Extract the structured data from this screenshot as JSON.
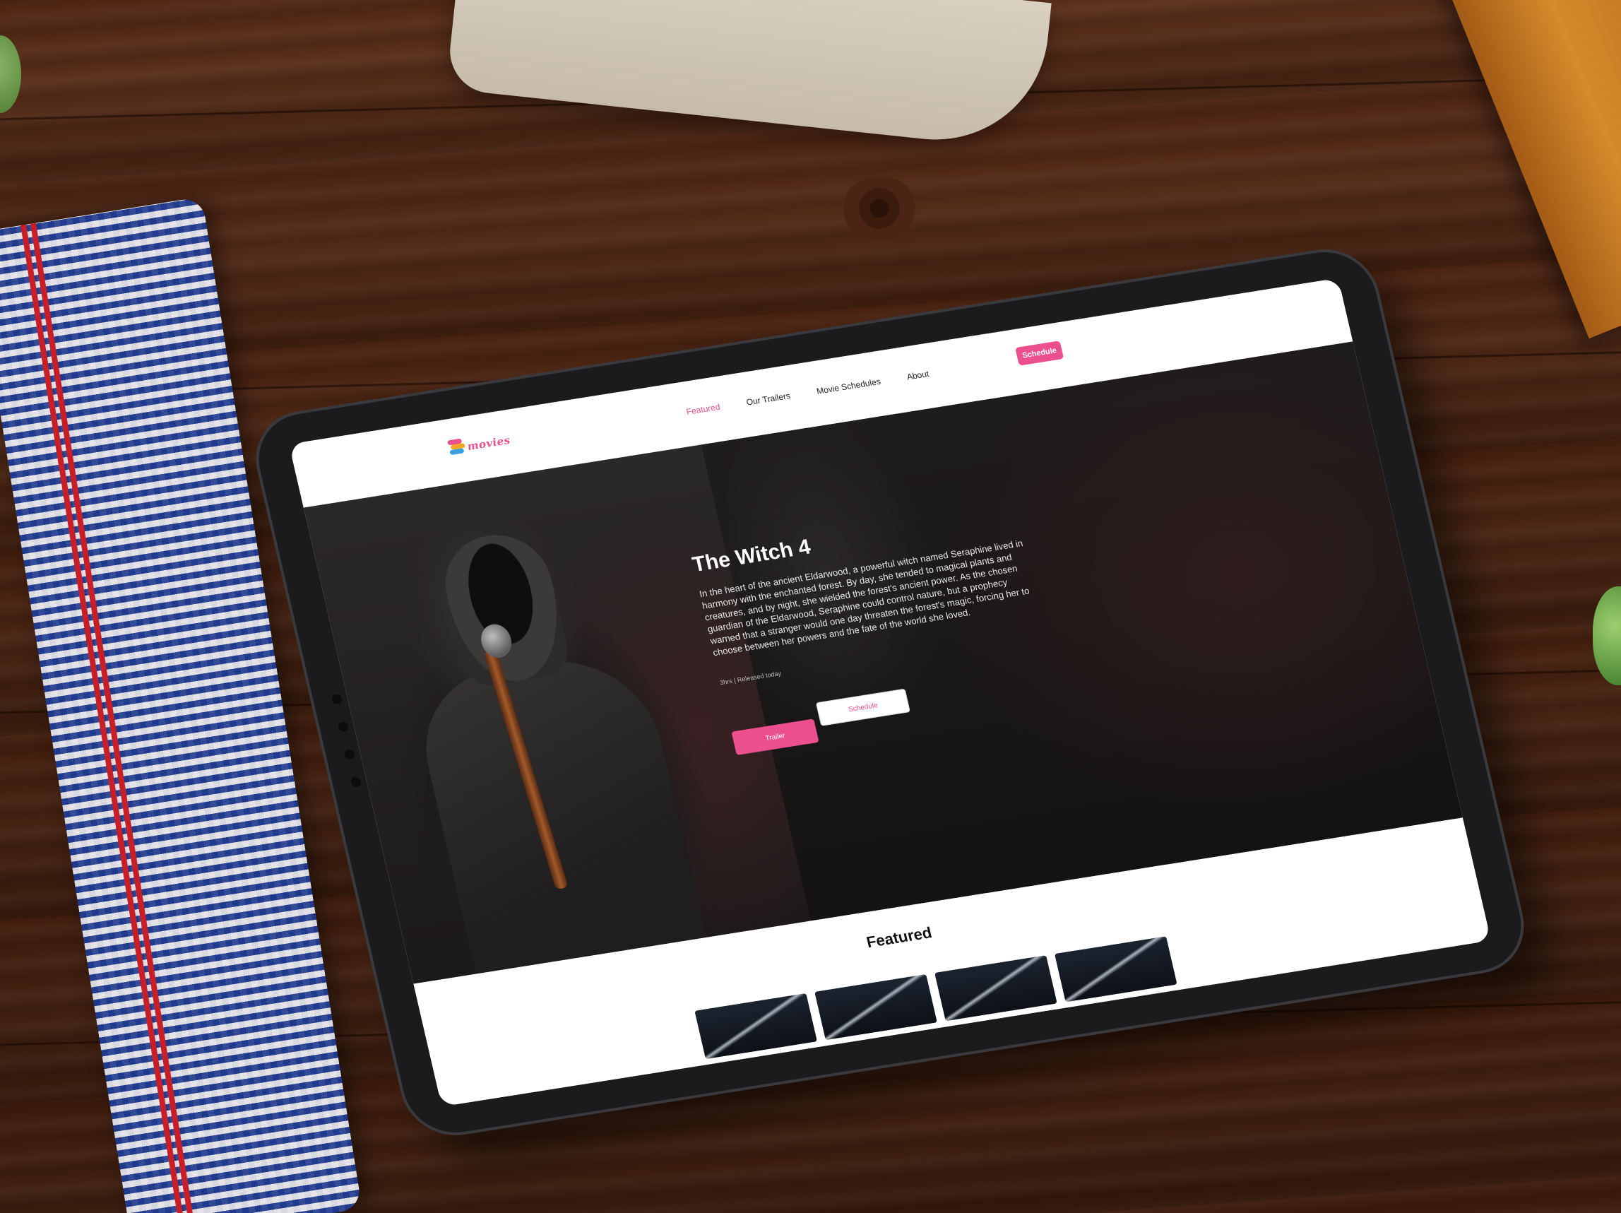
{
  "app": {
    "logo_text": "movies"
  },
  "nav": {
    "links": [
      {
        "label": "Featured",
        "active": true
      },
      {
        "label": "Our Trailers",
        "active": false
      },
      {
        "label": "Movie Schedules",
        "active": false
      },
      {
        "label": "About",
        "active": false
      }
    ],
    "schedule_button": "Schedule"
  },
  "hero": {
    "title": "The Witch 4",
    "description": "In the heart of the ancient Eldarwood, a powerful witch named Seraphine lived in harmony with the enchanted forest. By day, she tended to magical plants and creatures, and by night, she wielded the forest's ancient power. As the chosen guardian of the Eldarwood, Seraphine could control nature, but a prophecy warned that a stranger would one day threaten the forest's magic, forcing her to choose between her powers and the fate of the world she loved.",
    "meta": "3hrs | Released today",
    "trailer_button": "Trailer",
    "schedule_button": "Schedule"
  },
  "featured": {
    "title": "Featured",
    "card_count": 4
  },
  "colors": {
    "accent": "#ec4f8d",
    "hero_bg": "#171515",
    "bezel": "#1b1b1d"
  }
}
